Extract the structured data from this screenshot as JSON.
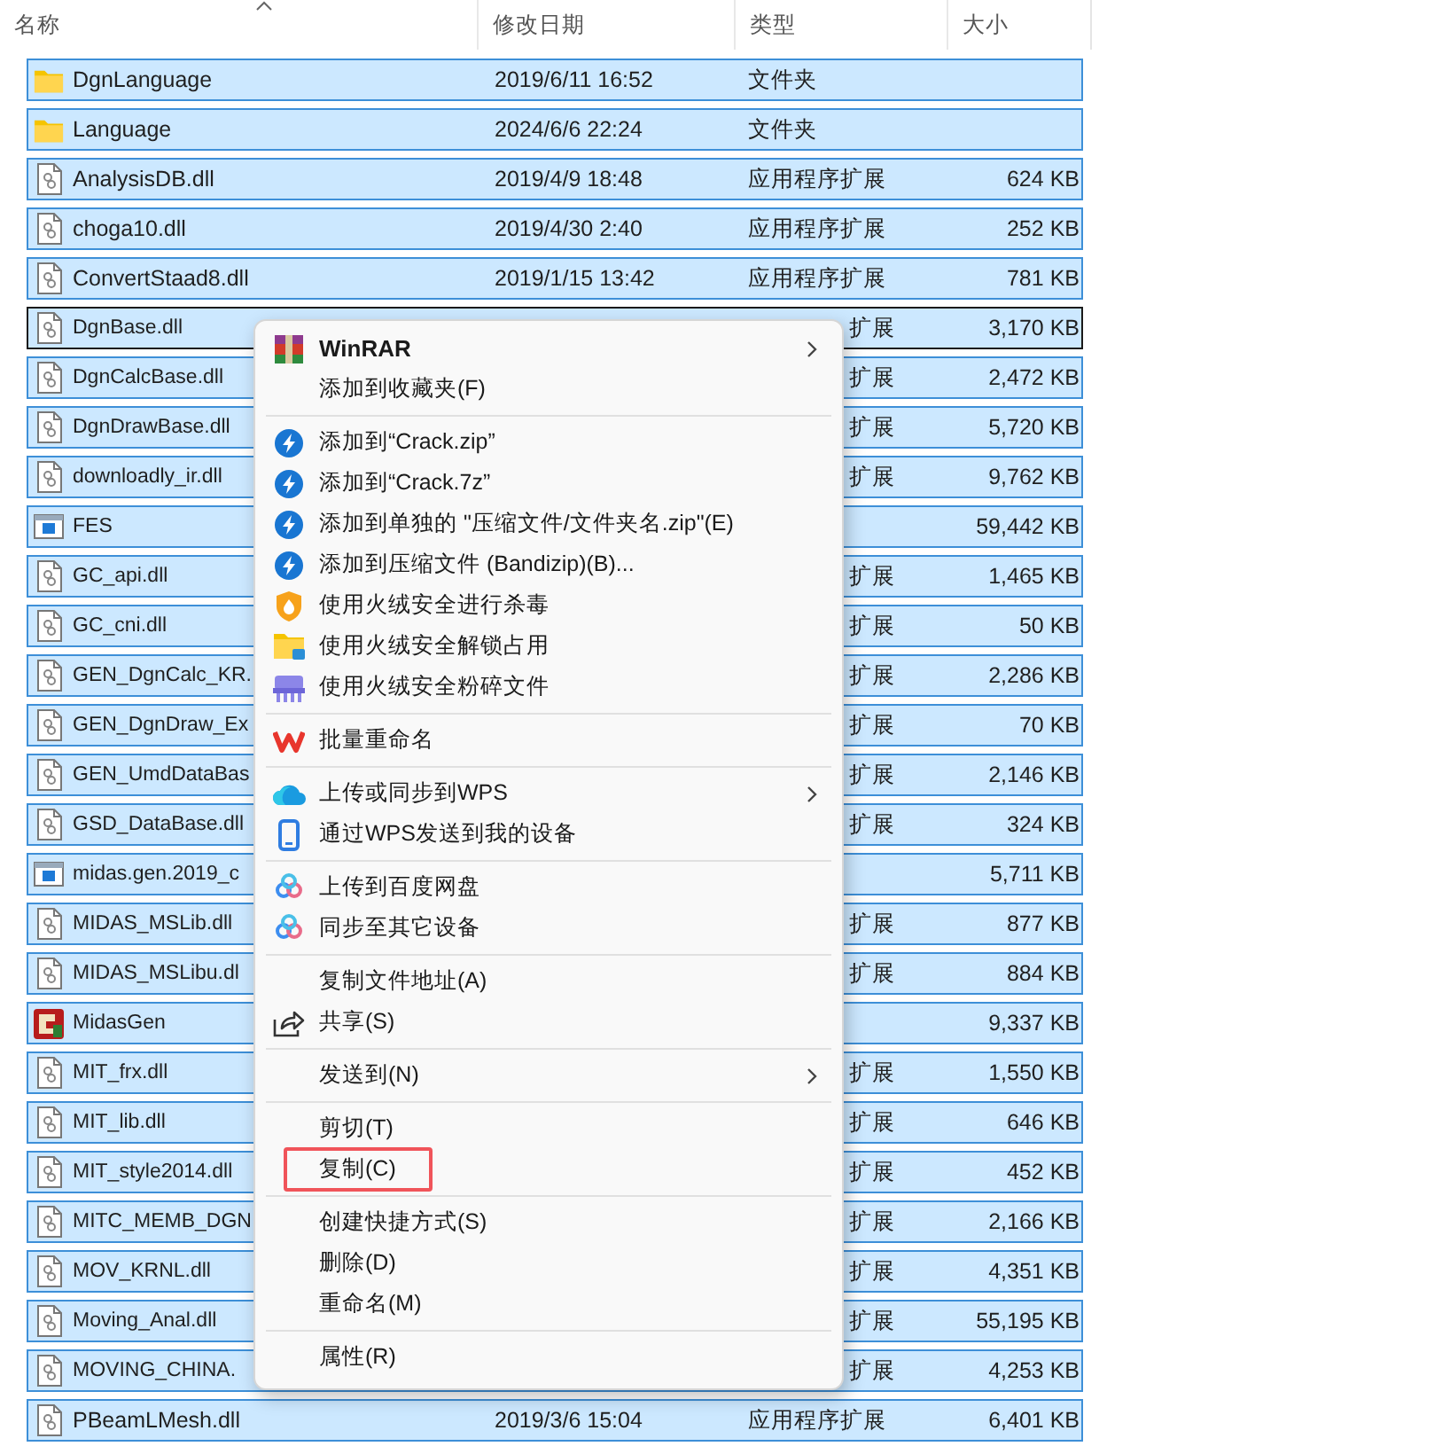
{
  "header": {
    "columns": [
      {
        "label": "名称",
        "sorted": true
      },
      {
        "label": "修改日期",
        "sorted": false
      },
      {
        "label": "类型",
        "sorted": false
      },
      {
        "label": "大小",
        "sorted": false
      }
    ]
  },
  "rows": [
    {
      "kind": "folder",
      "name": "DgnLanguage",
      "date": "2019/6/11 16:52",
      "type": "文件夹",
      "selected": true,
      "focused": false,
      "covered": false
    },
    {
      "kind": "folder",
      "name": "Language",
      "date": "2024/6/6 22:24",
      "type": "文件夹",
      "selected": true,
      "focused": false,
      "covered": false
    },
    {
      "kind": "dll",
      "name": "AnalysisDB.dll",
      "date": "2019/4/9 18:48",
      "type": "应用程序扩展",
      "size": "624 KB",
      "selected": true,
      "focused": false,
      "covered": false
    },
    {
      "kind": "dll",
      "name": "choga10.dll",
      "date": "2019/4/30 2:40",
      "type": "应用程序扩展",
      "size": "252 KB",
      "selected": true,
      "focused": false,
      "covered": false
    },
    {
      "kind": "dll",
      "name": "ConvertStaad8.dll",
      "date": "2019/1/15 13:42",
      "type": "应用程序扩展",
      "size": "781 KB",
      "selected": true,
      "focused": false,
      "covered": false
    },
    {
      "kind": "dll",
      "name": "DgnBase.dll",
      "type": "扩展",
      "size": "3,170 KB",
      "selected": true,
      "focused": true,
      "covered": true
    },
    {
      "kind": "dll",
      "name": "DgnCalcBase.dll",
      "type": "扩展",
      "size": "2,472 KB",
      "selected": true,
      "focused": false,
      "covered": true
    },
    {
      "kind": "dll",
      "name": "DgnDrawBase.dll",
      "type": "扩展",
      "size": "5,720 KB",
      "selected": true,
      "focused": false,
      "covered": true
    },
    {
      "kind": "dll",
      "name": "downloadly_ir.dll",
      "type": "扩展",
      "size": "9,762 KB",
      "selected": true,
      "focused": false,
      "covered": true
    },
    {
      "kind": "app",
      "name": "FES",
      "size": "59,442 KB",
      "selected": true,
      "focused": false,
      "covered": true
    },
    {
      "kind": "dll",
      "name": "GC_api.dll",
      "type": "扩展",
      "size": "1,465 KB",
      "selected": true,
      "focused": false,
      "covered": true
    },
    {
      "kind": "dll",
      "name": "GC_cni.dll",
      "type": "扩展",
      "size": "50 KB",
      "selected": true,
      "focused": false,
      "covered": true
    },
    {
      "kind": "dll",
      "name": "GEN_DgnCalc_KR.",
      "type": "扩展",
      "size": "2,286 KB",
      "selected": true,
      "focused": false,
      "covered": true
    },
    {
      "kind": "dll",
      "name": "GEN_DgnDraw_Ex",
      "type": "扩展",
      "size": "70 KB",
      "selected": true,
      "focused": false,
      "covered": true
    },
    {
      "kind": "dll",
      "name": "GEN_UmdDataBas",
      "type": "扩展",
      "size": "2,146 KB",
      "selected": true,
      "focused": false,
      "covered": true
    },
    {
      "kind": "dll",
      "name": "GSD_DataBase.dll",
      "type": "扩展",
      "size": "324 KB",
      "selected": true,
      "focused": false,
      "covered": true
    },
    {
      "kind": "app",
      "name": "midas.gen.2019_c",
      "size": "5,711 KB",
      "selected": true,
      "focused": false,
      "covered": true
    },
    {
      "kind": "dll",
      "name": "MIDAS_MSLib.dll",
      "type": "扩展",
      "size": "877 KB",
      "selected": true,
      "focused": false,
      "covered": true
    },
    {
      "kind": "dll",
      "name": "MIDAS_MSLibu.dl",
      "type": "扩展",
      "size": "884 KB",
      "selected": true,
      "focused": false,
      "covered": true
    },
    {
      "kind": "program",
      "name": "MidasGen",
      "size": "9,337 KB",
      "selected": true,
      "focused": false,
      "covered": true
    },
    {
      "kind": "dll",
      "name": "MIT_frx.dll",
      "type": "扩展",
      "size": "1,550 KB",
      "selected": true,
      "focused": false,
      "covered": true
    },
    {
      "kind": "dll",
      "name": "MIT_lib.dll",
      "type": "扩展",
      "size": "646 KB",
      "selected": true,
      "focused": false,
      "covered": true
    },
    {
      "kind": "dll",
      "name": "MIT_style2014.dll",
      "type": "扩展",
      "size": "452 KB",
      "selected": true,
      "focused": false,
      "covered": true
    },
    {
      "kind": "dll",
      "name": "MITC_MEMB_DGN",
      "type": "扩展",
      "size": "2,166 KB",
      "selected": true,
      "focused": false,
      "covered": true
    },
    {
      "kind": "dll",
      "name": "MOV_KRNL.dll",
      "type": "扩展",
      "size": "4,351 KB",
      "selected": true,
      "focused": false,
      "covered": true
    },
    {
      "kind": "dll",
      "name": "Moving_Anal.dll",
      "type": "扩展",
      "size": "55,195 KB",
      "selected": true,
      "focused": false,
      "covered": true
    },
    {
      "kind": "dll",
      "name": "MOVING_CHINA.",
      "type": "扩展",
      "size": "4,253 KB",
      "selected": true,
      "focused": false,
      "covered": true
    },
    {
      "kind": "dll",
      "name": "PBeamLMesh.dll",
      "date": "2019/3/6 15:04",
      "type": "应用程序扩展",
      "size": "6,401 KB",
      "selected": true,
      "focused": false,
      "covered": false
    }
  ],
  "context_menu": [
    {
      "kind": "item",
      "label": "WinRAR",
      "bold": true,
      "submenu": true,
      "annotated": false
    },
    {
      "kind": "item",
      "label": "添加到收藏夹(F)",
      "bold": false,
      "submenu": false,
      "annotated": false
    },
    {
      "kind": "separator"
    },
    {
      "kind": "item",
      "label": "添加到“Crack.zip”",
      "bold": false,
      "submenu": false,
      "annotated": false
    },
    {
      "kind": "item",
      "label": "添加到“Crack.7z”",
      "bold": false,
      "submenu": false,
      "annotated": false
    },
    {
      "kind": "item",
      "label": "添加到单独的 \"压缩文件/文件夹名.zip\"(E)",
      "bold": false,
      "submenu": false,
      "annotated": false
    },
    {
      "kind": "item",
      "label": "添加到压缩文件 (Bandizip)(B)...",
      "bold": false,
      "submenu": false,
      "annotated": false
    },
    {
      "kind": "item",
      "label": "使用火绒安全进行杀毒",
      "bold": false,
      "submenu": false,
      "annotated": false
    },
    {
      "kind": "item",
      "label": "使用火绒安全解锁占用",
      "bold": false,
      "submenu": false,
      "annotated": false
    },
    {
      "kind": "item",
      "label": "使用火绒安全粉碎文件",
      "bold": false,
      "submenu": false,
      "annotated": false
    },
    {
      "kind": "separator"
    },
    {
      "kind": "item",
      "label": "批量重命名",
      "bold": false,
      "submenu": false,
      "annotated": false
    },
    {
      "kind": "separator"
    },
    {
      "kind": "item",
      "label": "上传或同步到WPS",
      "bold": false,
      "submenu": true,
      "annotated": false
    },
    {
      "kind": "item",
      "label": "通过WPS发送到我的设备",
      "bold": false,
      "submenu": false,
      "annotated": false
    },
    {
      "kind": "separator"
    },
    {
      "kind": "item",
      "label": "上传到百度网盘",
      "bold": false,
      "submenu": false,
      "annotated": false
    },
    {
      "kind": "item",
      "label": "同步至其它设备",
      "bold": false,
      "submenu": false,
      "annotated": false
    },
    {
      "kind": "separator"
    },
    {
      "kind": "item",
      "label": "复制文件地址(A)",
      "bold": false,
      "submenu": false,
      "annotated": false
    },
    {
      "kind": "item",
      "label": "共享(S)",
      "bold": false,
      "submenu": false,
      "annotated": false
    },
    {
      "kind": "separator"
    },
    {
      "kind": "item",
      "label": "发送到(N)",
      "bold": false,
      "submenu": true,
      "annotated": false
    },
    {
      "kind": "separator"
    },
    {
      "kind": "item",
      "label": "剪切(T)",
      "bold": false,
      "submenu": false,
      "annotated": false
    },
    {
      "kind": "item",
      "label": "复制(C)",
      "bold": false,
      "submenu": false,
      "annotated": true
    },
    {
      "kind": "separator"
    },
    {
      "kind": "item",
      "label": "创建快捷方式(S)",
      "bold": false,
      "submenu": false,
      "annotated": false
    },
    {
      "kind": "item",
      "label": "删除(D)",
      "bold": false,
      "submenu": false,
      "annotated": false
    },
    {
      "kind": "item",
      "label": "重命名(M)",
      "bold": false,
      "submenu": false,
      "annotated": false
    },
    {
      "kind": "separator"
    },
    {
      "kind": "item",
      "label": "属性(R)",
      "bold": false,
      "submenu": false,
      "annotated": false
    }
  ]
}
